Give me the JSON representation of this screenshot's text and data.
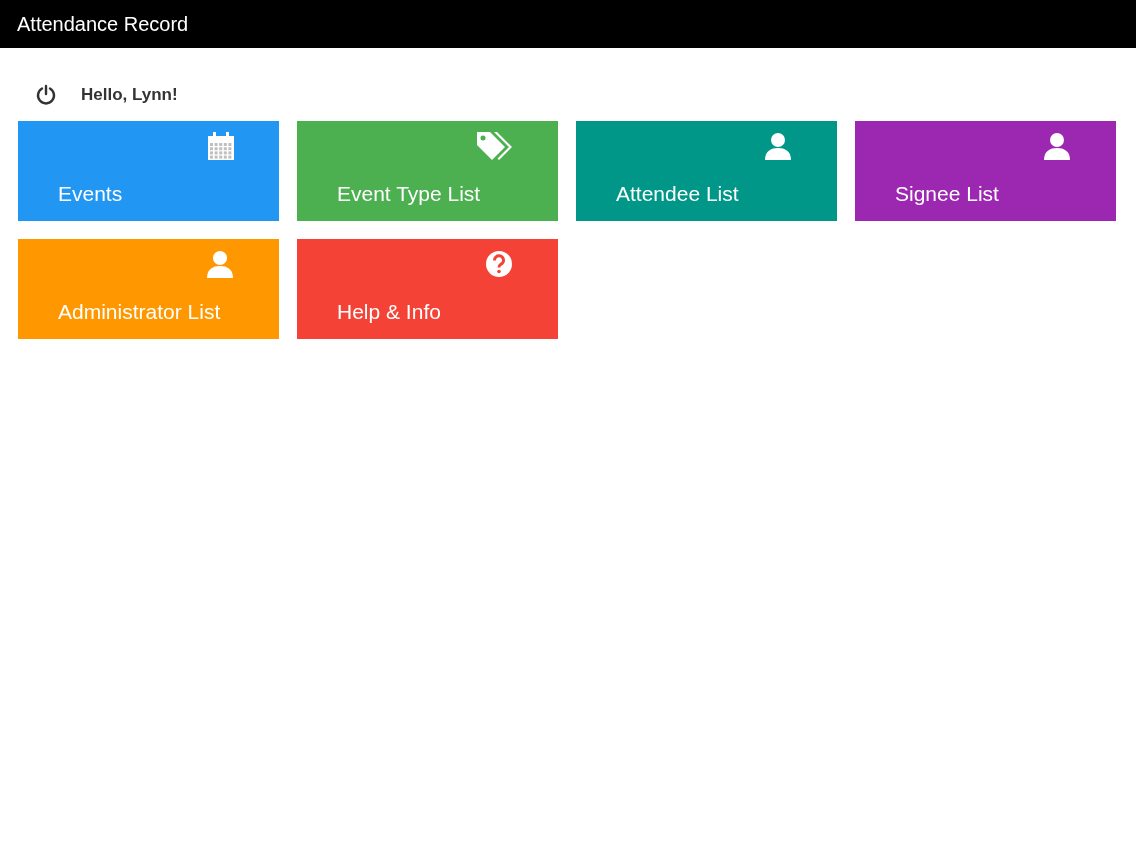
{
  "app_bar": {
    "title": "Attendance Record"
  },
  "greeting": "Hello, Lynn!",
  "tiles": [
    {
      "label": "Events",
      "color": "#2196f3"
    },
    {
      "label": "Event Type List",
      "color": "#4caf50"
    },
    {
      "label": "Attendee List",
      "color": "#009688"
    },
    {
      "label": "Signee List",
      "color": "#9c27b0"
    },
    {
      "label": "Administrator List",
      "color": "#ff9800"
    },
    {
      "label": "Help & Info",
      "color": "#f44336"
    }
  ]
}
